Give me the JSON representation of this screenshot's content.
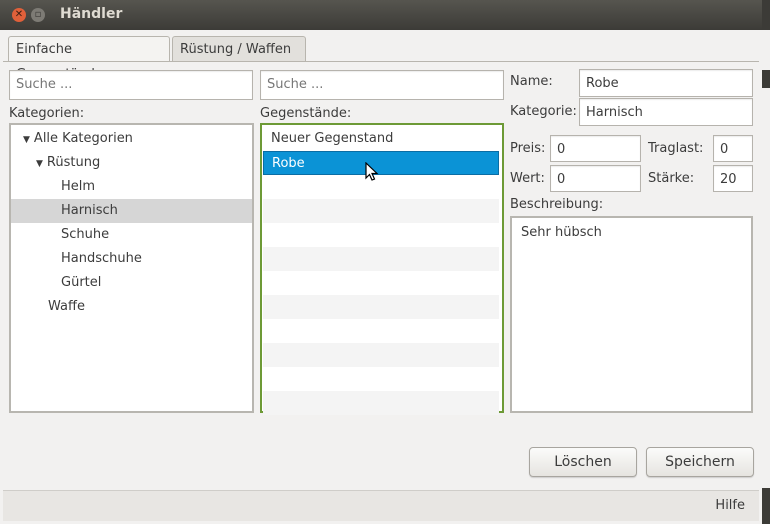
{
  "window": {
    "title": "Händler"
  },
  "tabs": [
    {
      "label": "Einfache Gegenstände",
      "active": true
    },
    {
      "label": "Rüstung / Waffen",
      "active": false
    }
  ],
  "categories": {
    "search_placeholder": "Suche ...",
    "heading": "Kategorien:",
    "tree": [
      {
        "label": "Alle Kategorien",
        "level": 0,
        "expanded": true
      },
      {
        "label": "Rüstung",
        "level": 1,
        "expanded": true
      },
      {
        "label": "Helm",
        "level": 2
      },
      {
        "label": "Harnisch",
        "level": 2,
        "selected": true
      },
      {
        "label": "Schuhe",
        "level": 2
      },
      {
        "label": "Handschuhe",
        "level": 2
      },
      {
        "label": "Gürtel",
        "level": 2
      },
      {
        "label": "Waffe",
        "level": 1
      }
    ]
  },
  "items": {
    "search_placeholder": "Suche ...",
    "heading": "Gegenstände:",
    "list": [
      {
        "label": "Neuer Gegenstand"
      },
      {
        "label": "Robe",
        "selected": true
      }
    ]
  },
  "details": {
    "name_label": "Name:",
    "name_value": "Robe",
    "category_label": "Kategorie:",
    "category_value": "Harnisch",
    "price_label": "Preis:",
    "price_value": "0",
    "carry_label": "Traglast:",
    "carry_value": "0",
    "value_label": "Wert:",
    "value_value": "0",
    "strength_label": "Stärke:",
    "strength_value": "20",
    "description_label": "Beschreibung:",
    "description_value": "Sehr hübsch"
  },
  "buttons": {
    "delete": "Löschen",
    "save": "Speichern"
  },
  "status": {
    "help": "Hilfe"
  },
  "colors": {
    "selection": "#0b93d6",
    "focus_border": "#6d9a36",
    "close_button": "#e0603a"
  }
}
